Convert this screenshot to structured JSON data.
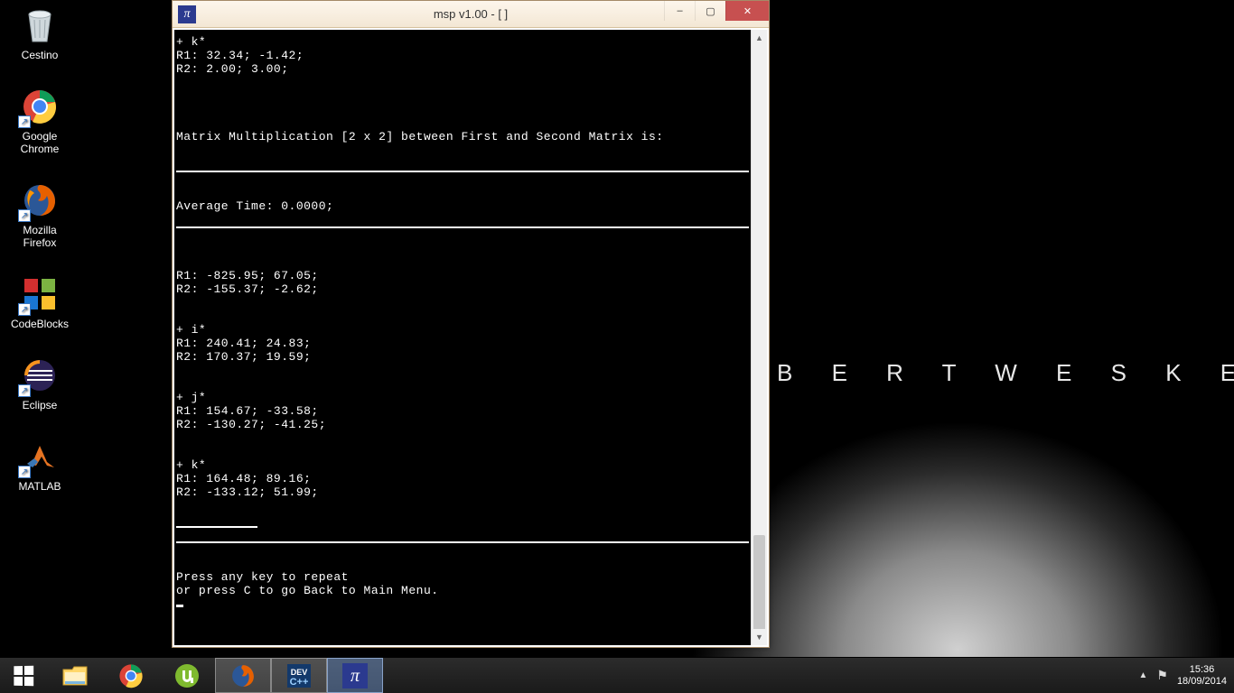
{
  "wallpaper": {
    "text_fragment": "B E R T   W E S K E R"
  },
  "desktop": {
    "icons": [
      {
        "label": "Cestino"
      },
      {
        "label": "Google\nChrome"
      },
      {
        "label": "Mozilla\nFirefox"
      },
      {
        "label": "CodeBlocks"
      },
      {
        "label": "Eclipse"
      },
      {
        "label": "MATLAB"
      }
    ]
  },
  "window": {
    "title": "msp v1.00 - [  ]",
    "controls": {
      "minimize": "–",
      "maximize": "▢",
      "close": "✕"
    },
    "console": {
      "block_k_top": "+ k*\nR1: 32.34; -1.42;\nR2: 2.00; 3.00;",
      "heading": "Matrix Multiplication [2 x 2] between First and Second Matrix is:",
      "avg": "Average Time: 0.0000;",
      "block0": "R1: -825.95; 67.05;\nR2: -155.37; -2.62;",
      "block_i": "+ i*\nR1: 240.41; 24.83;\nR2: 170.37; 19.59;",
      "block_j": "+ j*\nR1: 154.67; -33.58;\nR2: -130.27; -41.25;",
      "block_k": "+ k*\nR1: 164.48; 89.16;\nR2: -133.12; 51.99;",
      "prompt": "Press any key to repeat\nor press C to go Back to Main Menu."
    }
  },
  "taskbar": {
    "tray": {
      "time": "15:36",
      "date": "18/09/2014"
    }
  }
}
